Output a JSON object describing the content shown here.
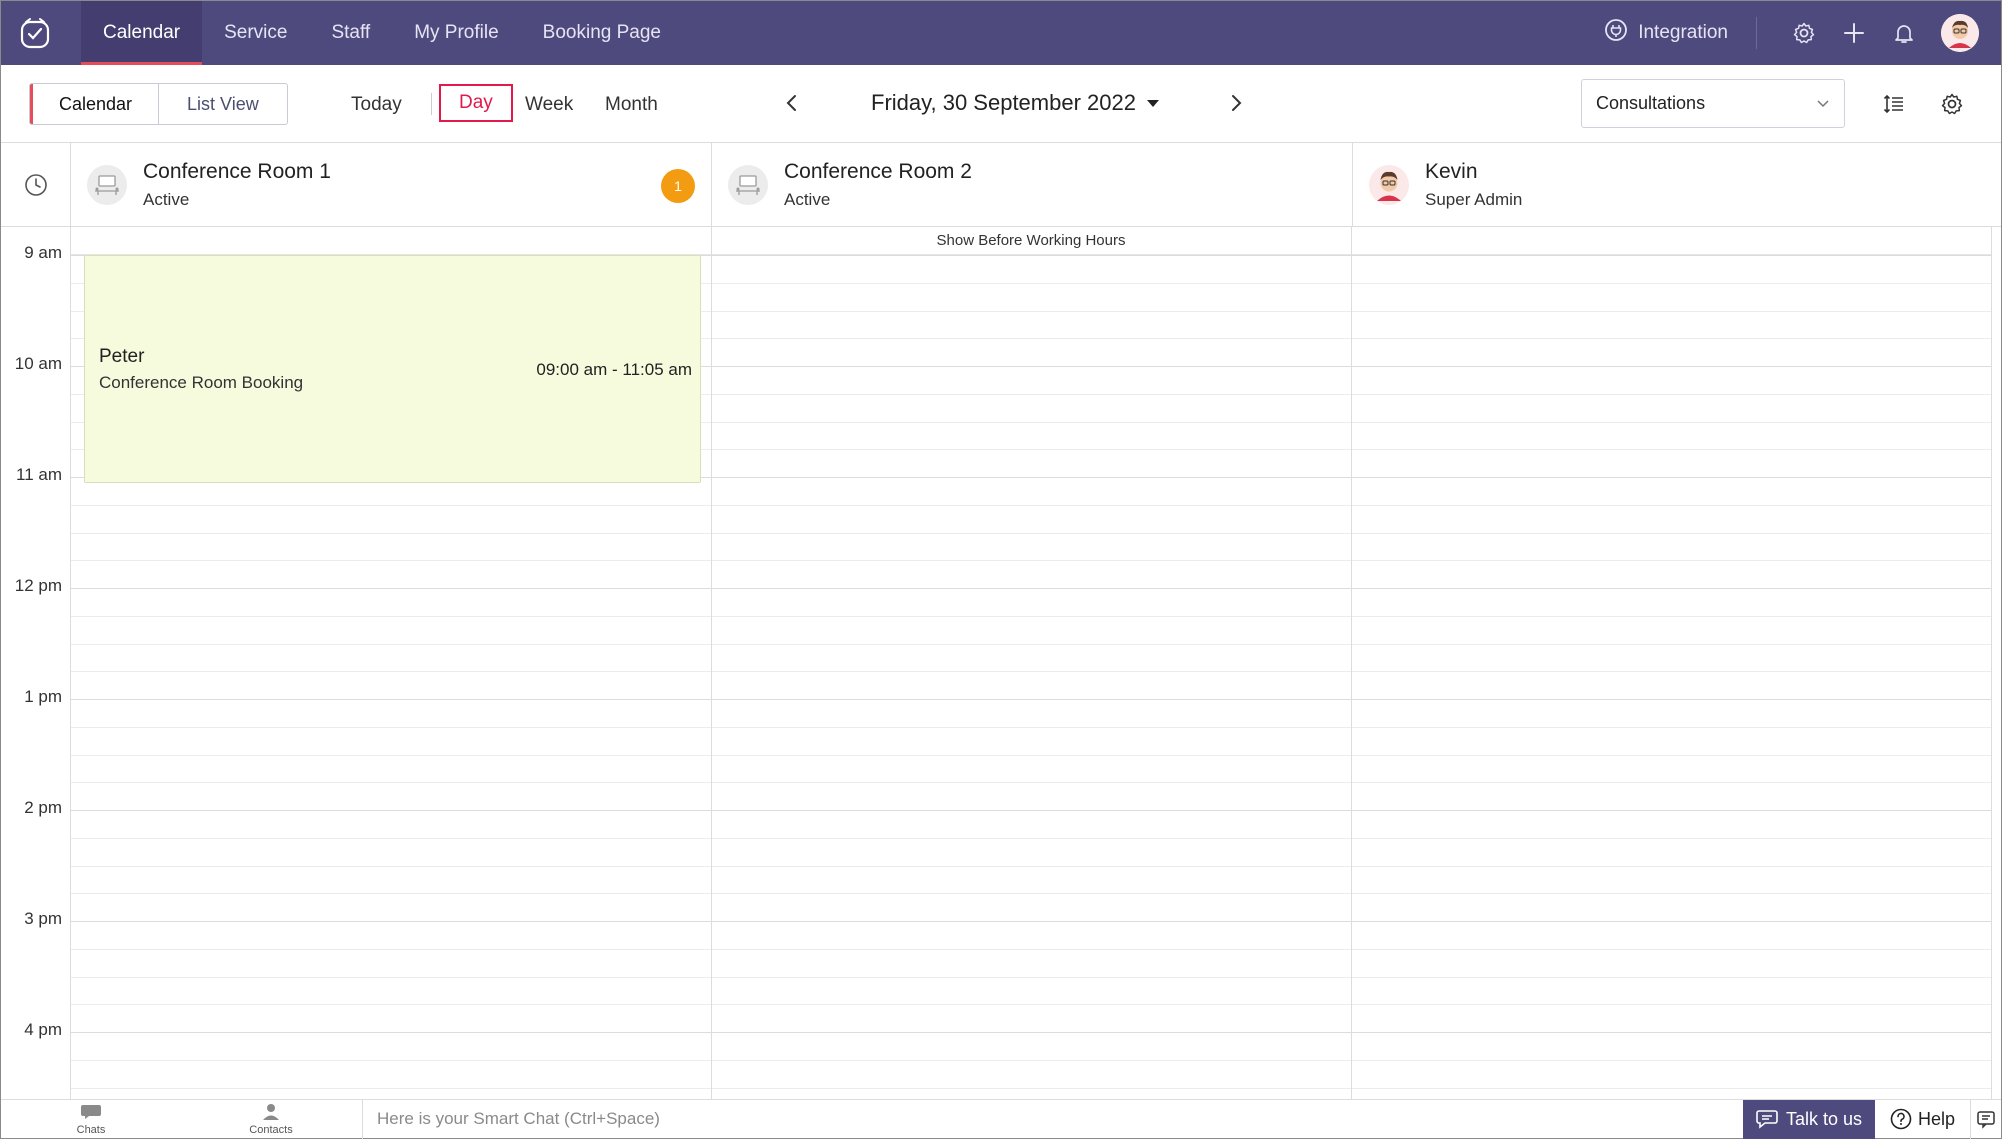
{
  "nav": {
    "items": [
      {
        "label": "Calendar",
        "active": true
      },
      {
        "label": "Service",
        "active": false
      },
      {
        "label": "Staff",
        "active": false
      },
      {
        "label": "My Profile",
        "active": false
      },
      {
        "label": "Booking Page",
        "active": false
      }
    ],
    "integration_label": "Integration"
  },
  "toolbar": {
    "calendar_label": "Calendar",
    "listview_label": "List View",
    "today_label": "Today",
    "day_label": "Day",
    "week_label": "Week",
    "month_label": "Month",
    "date_label": "Friday, 30 September 2022",
    "select_value": "Consultations"
  },
  "resources": [
    {
      "name": "Conference Room 1",
      "status": "Active",
      "badge": "1"
    },
    {
      "name": "Conference Room 2",
      "status": "Active"
    },
    {
      "name": "Kevin",
      "status": "Super Admin"
    }
  ],
  "grid": {
    "before_hours_label": "Show Before Working Hours",
    "times": [
      "9 am",
      "10 am",
      "11 am",
      "12 pm",
      "1 pm",
      "2 pm",
      "3 pm",
      "4 pm"
    ]
  },
  "event": {
    "customer": "Peter",
    "service": "Conference Room Booking",
    "time": "09:00 am - 11:05 am"
  },
  "bottombar": {
    "chats_label": "Chats",
    "contacts_label": "Contacts",
    "smartchat_placeholder": "Here is your Smart Chat (Ctrl+Space)",
    "talk_label": "Talk to us",
    "help_label": "Help"
  },
  "colors": {
    "nav_bg": "#4f4a7e",
    "accent": "#e2194a",
    "event_bg": "#f6fbde",
    "badge": "#f39c12"
  }
}
